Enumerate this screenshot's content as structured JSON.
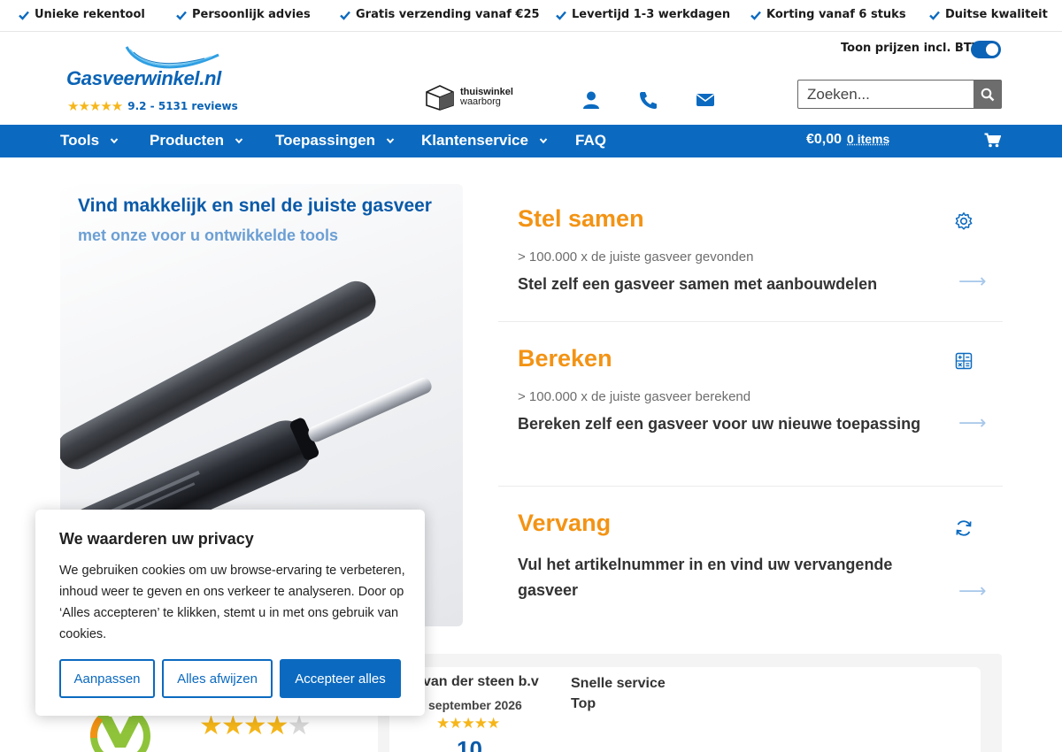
{
  "usp": [
    "Unieke rekentool",
    "Persoonlijk advies",
    "Gratis verzending vanaf €25",
    "Levertijd 1-3 werkdagen",
    "Korting vanaf 6 stuks",
    "Duitse kwaliteit"
  ],
  "header": {
    "logo": "Gasveerwinkel.nl",
    "rating": "9.2 - 5131 reviews",
    "waarborg_line1": "thuiswinkel",
    "waarborg_line2": "waarborg",
    "btw_label": "Toon prijzen incl. BTW",
    "btw_on": true,
    "search_placeholder": "Zoeken..."
  },
  "nav": {
    "items": [
      "Tools",
      "Producten",
      "Toepassingen",
      "Klantenservice",
      "FAQ"
    ],
    "cart_total": "€0,00",
    "cart_items": "0 items"
  },
  "hero": {
    "title": "Vind makkelijk en snel de juiste gasveer",
    "subtitle": "met onze voor u ontwikkelde tools"
  },
  "tools": [
    {
      "title": "Stel samen",
      "stat": "> 100.000 x de juiste gasveer gevonden",
      "desc": "Stel zelf een gasveer samen met aanbouwdelen",
      "icon": "gear-icon"
    },
    {
      "title": "Bereken",
      "stat": "> 100.000 x de juiste gasveer berekend",
      "desc": "Bereken zelf een gasveer voor uw nieuwe toepassing",
      "icon": "calculator-icon"
    },
    {
      "title": "Vervang",
      "stat": "",
      "desc": "Vul het artikelnummer in en vind uw vervangende gasveer",
      "icon": "refresh-icon"
    }
  ],
  "review": {
    "name": "van der steen b.v",
    "date": "september 2026",
    "score": "10",
    "title": "Snelle service",
    "text": "Top"
  },
  "cookie": {
    "title": "We waarderen uw privacy",
    "text": "We gebruiken cookies om uw browse-ervaring te verbeteren, inhoud weer te geven en ons verkeer te analyseren. Door op ‘Alles accepteren’ te klikken, stemt u in met ons gebruik van cookies.",
    "btn_customize": "Aanpassen",
    "btn_reject": "Alles afwijzen",
    "btn_accept": "Accepteer alles"
  },
  "colors": {
    "brand_blue": "#0b6ac0",
    "accent_orange": "#f39314",
    "star_yellow": "#f6b619"
  }
}
